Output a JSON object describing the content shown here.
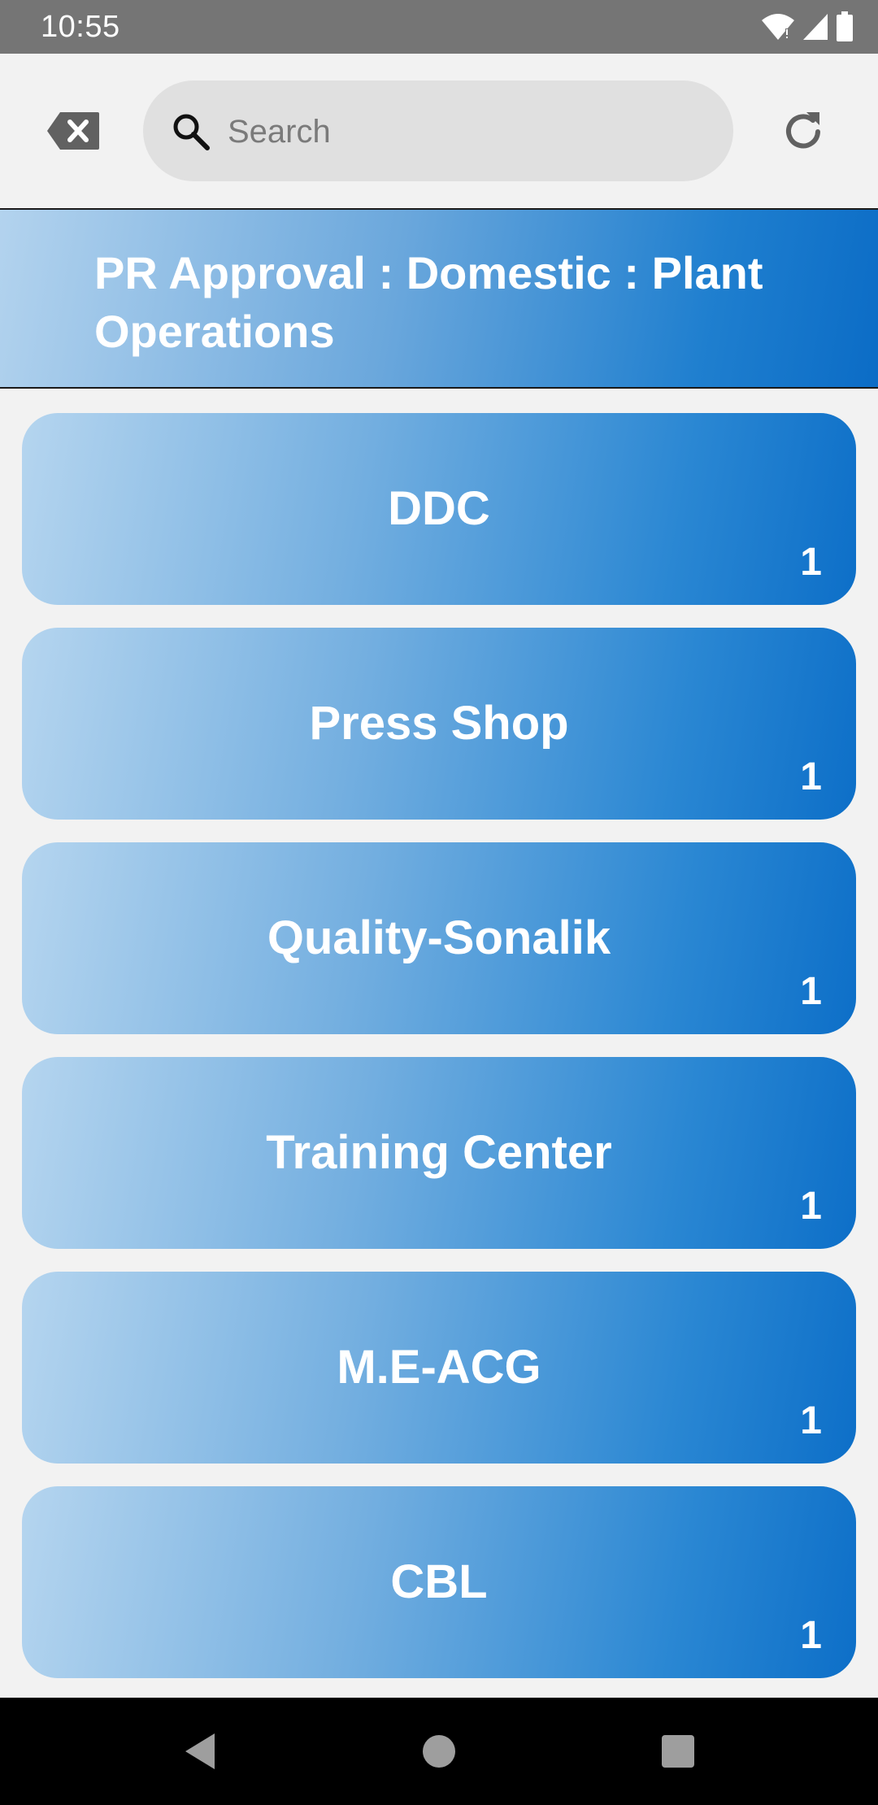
{
  "status_bar": {
    "time": "10:55"
  },
  "toolbar": {
    "clear_icon": "backspace-clear-icon",
    "search": {
      "placeholder": "Search",
      "value": ""
    },
    "refresh_icon": "refresh-icon"
  },
  "header": {
    "title": "PR Approval : Domestic : Plant Operations"
  },
  "items": [
    {
      "label": "DDC",
      "count": "1"
    },
    {
      "label": "Press Shop",
      "count": "1"
    },
    {
      "label": "Quality-Sonalik",
      "count": "1"
    },
    {
      "label": "Training Center",
      "count": "1"
    },
    {
      "label": "M.E-ACG",
      "count": "1"
    },
    {
      "label": "CBL",
      "count": "1"
    }
  ],
  "nav_bar": {
    "icons": [
      "back-icon",
      "home-icon",
      "recents-icon"
    ]
  },
  "colors": {
    "status_bar": "#757575",
    "background": "#f2f2f2",
    "gradient_start": "#b5d5ef",
    "gradient_end": "#0d6fc8",
    "search_field": "#e0e0e0"
  }
}
